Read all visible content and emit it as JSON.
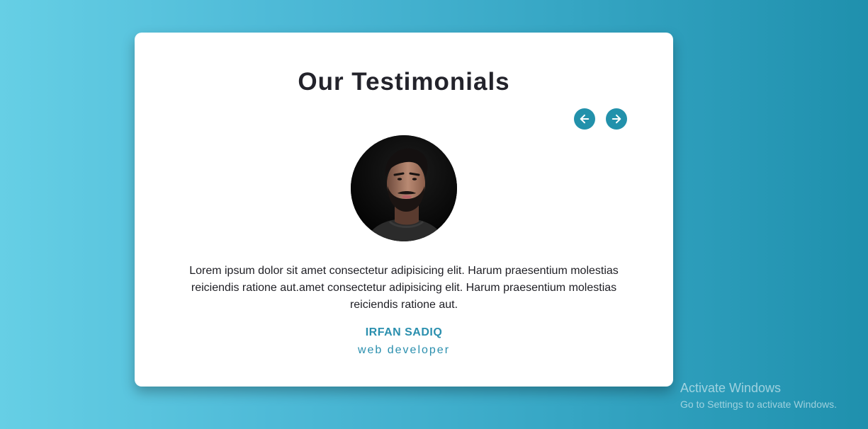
{
  "testimonials": {
    "title": "Our Testimonials",
    "nav": {
      "prev_icon": "arrow-left-icon",
      "next_icon": "arrow-right-icon"
    },
    "current": {
      "avatar_icon": "person-avatar",
      "quote": "Lorem ipsum dolor sit amet consectetur adipisicing elit. Harum praesentium molestias reiciendis ratione aut.amet consectetur adipisicing elit. Harum praesentium molestias reiciendis ratione aut.",
      "name": "IRFAN SADIQ",
      "role": "web developer"
    }
  },
  "watermark": {
    "title": "Activate Windows",
    "subtitle": "Go to Settings to activate Windows."
  },
  "colors": {
    "accent": "#2291ab",
    "name_text": "#2a8fae",
    "title_text": "#23232b",
    "background_start": "#66cfe5",
    "background_end": "#1f90ad",
    "card": "#ffffff"
  }
}
